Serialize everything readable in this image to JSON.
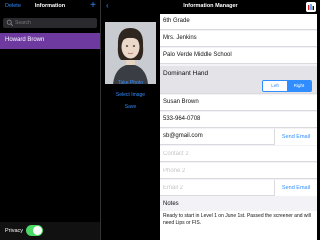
{
  "left_panel": {
    "delete_label": "Delete",
    "title": "Information",
    "add_label": "+",
    "search_placeholder": "Search",
    "selected_contact": "Howard  Brown",
    "privacy_label": "Privacy",
    "privacy_on": true
  },
  "right_panel": {
    "back_label": "‹",
    "title": "Information Manager",
    "photo_actions": {
      "take_photo": "Take Photo",
      "select_image": "Select Image",
      "save": "Save"
    },
    "fields": {
      "grade": "6th Grade",
      "teacher": "Mrs. Jenkins",
      "school": "Palo Verde Middle School",
      "dominant_hand_label": "Dominant Hand",
      "hand_left": "Left",
      "hand_right": "Right",
      "hand_selected": "Right",
      "parent_name": "Susan Brown",
      "phone": "533-964-0708",
      "email": "sb@gmail.com",
      "send_email_label": "Send Email",
      "contact2_placeholder": "Contact 2",
      "phone2_placeholder": "Phone 2",
      "email2_placeholder": "Email 2",
      "notes_label": "Notes",
      "notes_text": "Ready to start in Level 1 on June 1st. Passed the screener and will need Lips or FIS."
    }
  },
  "colors": {
    "accent": "#2f8dff",
    "selected_row": "#6e3aa0",
    "toggle_on": "#4cd964"
  }
}
